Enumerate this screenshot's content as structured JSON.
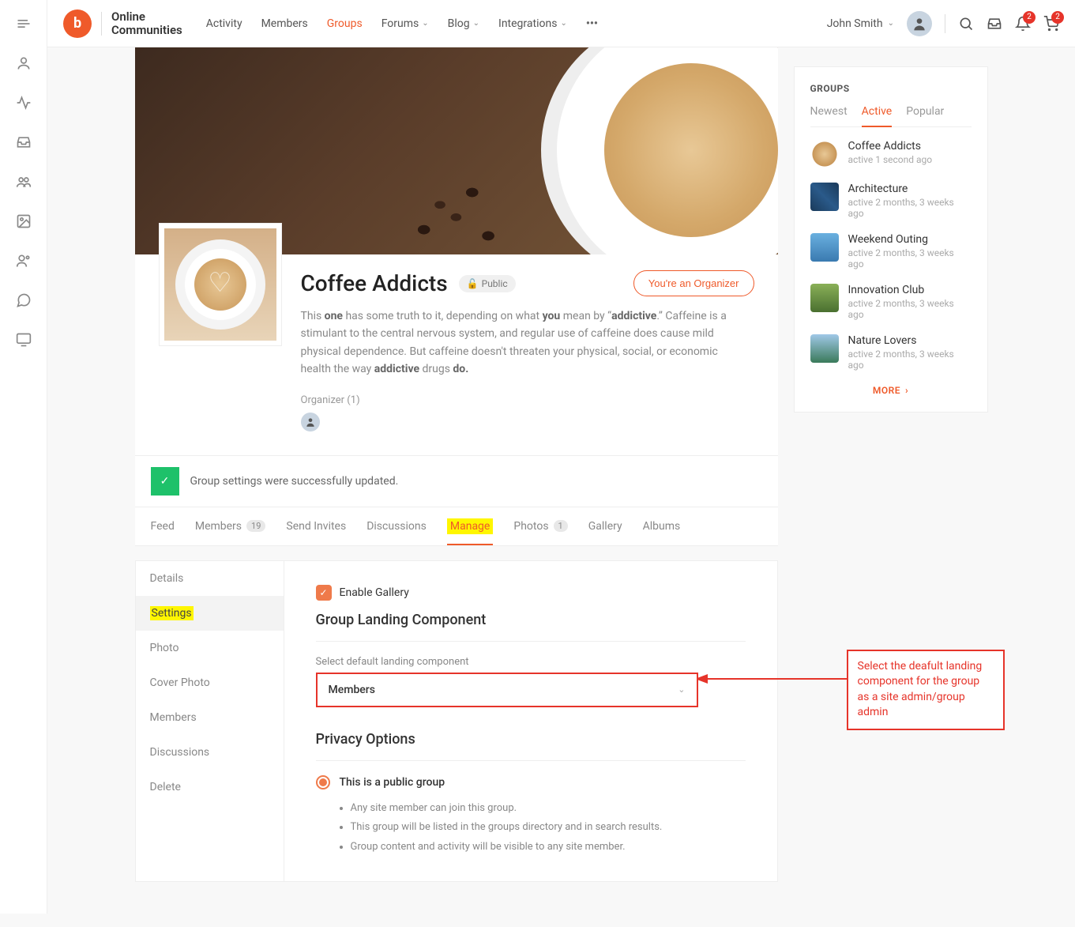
{
  "brand": {
    "line1": "Online",
    "line2": "Communities"
  },
  "topnav": {
    "activity": "Activity",
    "members": "Members",
    "groups": "Groups",
    "forums": "Forums",
    "blog": "Blog",
    "integrations": "Integrations"
  },
  "user": {
    "name": "John Smith"
  },
  "badges": {
    "bell": "2",
    "cart": "2"
  },
  "group": {
    "title": "Coffee Addicts",
    "visibility": "Public",
    "org_btn": "You're an Organizer",
    "desc_html": "This <b>one</b> has some truth to it, depending on what <b>you</b> mean by “<b>addictive</b>.” Caffeine is a stimulant to the central nervous system, and regular use of caffeine does cause mild physical dependence. But caffeine doesn't threaten your physical, social, or economic health the way <b>addictive</b> drugs <b>do.</b>",
    "organizer_label": "Organizer (1)"
  },
  "alert": "Group settings were successfully updated.",
  "tabs": {
    "feed": "Feed",
    "members": "Members",
    "members_count": "19",
    "send_invites": "Send Invites",
    "discussions": "Discussions",
    "manage": "Manage",
    "photos": "Photos",
    "photos_count": "1",
    "gallery": "Gallery",
    "albums": "Albums"
  },
  "manage_nav": {
    "details": "Details",
    "settings": "Settings",
    "photo": "Photo",
    "cover_photo": "Cover Photo",
    "members": "Members",
    "discussions": "Discussions",
    "delete": "Delete"
  },
  "settings": {
    "enable_gallery": "Enable Gallery",
    "landing_heading": "Group Landing Component",
    "landing_label": "Select default landing component",
    "landing_value": "Members",
    "privacy_heading": "Privacy Options",
    "public_label": "This is a public group",
    "bullets": [
      "Any site member can join this group.",
      "This group will be listed in the groups directory and in search results.",
      "Group content and activity will be visible to any site member."
    ]
  },
  "sidebar": {
    "heading": "GROUPS",
    "tab_newest": "Newest",
    "tab_active": "Active",
    "tab_popular": "Popular",
    "items": [
      {
        "title": "Coffee Addicts",
        "meta": "active 1 second ago"
      },
      {
        "title": "Architecture",
        "meta": "active 2 months, 3 weeks ago"
      },
      {
        "title": "Weekend Outing",
        "meta": "active 2 months, 3 weeks ago"
      },
      {
        "title": "Innovation Club",
        "meta": "active 2 months, 3 weeks ago"
      },
      {
        "title": "Nature Lovers",
        "meta": "active 2 months, 3 weeks ago"
      }
    ],
    "more": "MORE"
  },
  "annotation": "Select the deafult landing component for the group as a site admin/group admin"
}
